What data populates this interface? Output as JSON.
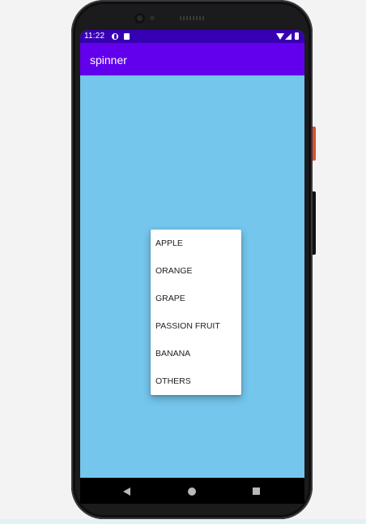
{
  "status_bar": {
    "time": "11:22",
    "icons": [
      "notification-icon",
      "sim-card-icon",
      "wifi-icon",
      "signal-icon",
      "battery-icon"
    ]
  },
  "app_bar": {
    "title": "spinner"
  },
  "colors": {
    "status_bar": "#3700b3",
    "app_bar": "#6200ee",
    "screen_background": "#74c6ec",
    "popup_background": "#ffffff"
  },
  "spinner": {
    "items": [
      "APPLE",
      "ORANGE",
      "GRAPE",
      "PASSION FRUIT",
      "BANANA",
      "OTHERS"
    ]
  },
  "nav_bar": {
    "icons": [
      "back-icon",
      "home-icon",
      "recents-icon"
    ]
  }
}
